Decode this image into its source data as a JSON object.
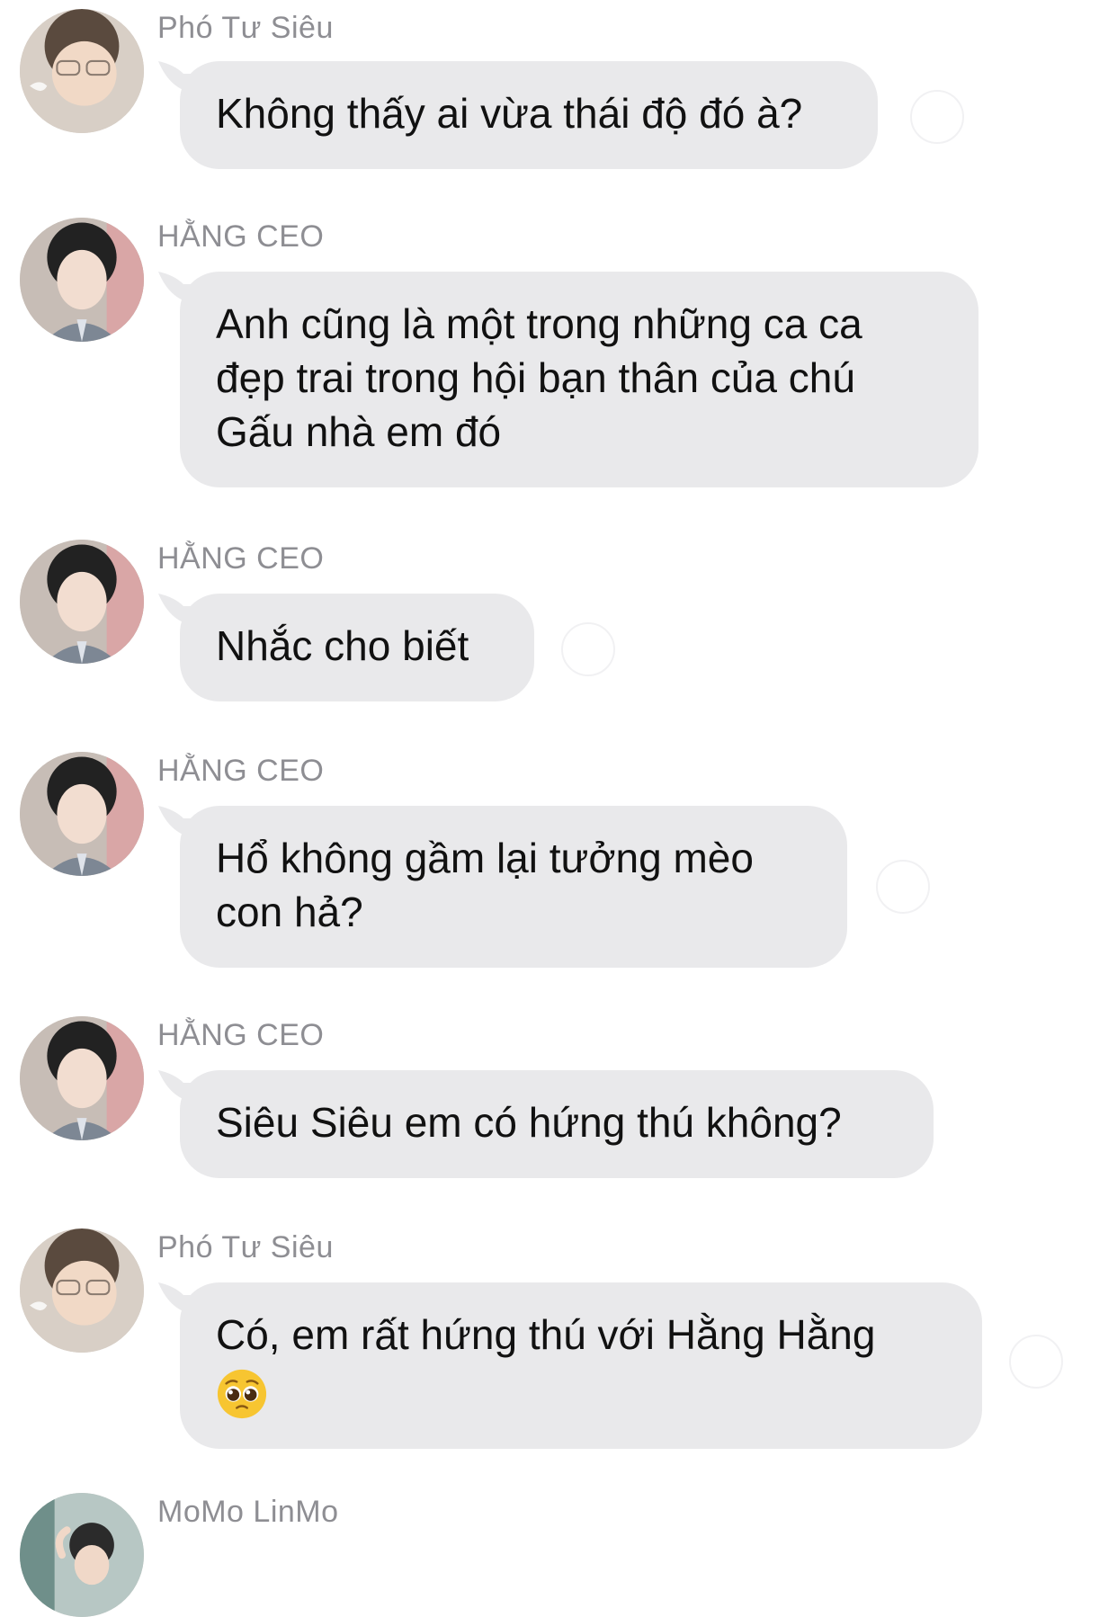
{
  "messages": [
    {
      "sender": "Phó Tư Siêu",
      "text": "Không thấy ai vừa thái độ đó à?"
    },
    {
      "sender": "HẰNG CEO",
      "lines": [
        "Anh cũng là một trong những ca ca",
        "đẹp trai trong hội bạn thân của chú",
        "Gấu nhà em đó"
      ]
    },
    {
      "sender": "HẰNG CEO",
      "text": "Nhắc cho biết"
    },
    {
      "sender": "HẰNG CEO",
      "lines": [
        "Hổ không gầm lại tưởng mèo",
        "con hả?"
      ]
    },
    {
      "sender": "HẰNG CEO",
      "text": "Siêu Siêu em có hứng thú không?"
    },
    {
      "sender": "Phó Tư Siêu",
      "text": "Có, em rất hứng thú với Hằng Hằng",
      "emoji": "pleading-face-emoji"
    },
    {
      "sender": "MoMo LinMo"
    }
  ],
  "colors": {
    "bubble": "#e9e9eb",
    "sender": "#8e8e93",
    "text": "#111111"
  }
}
